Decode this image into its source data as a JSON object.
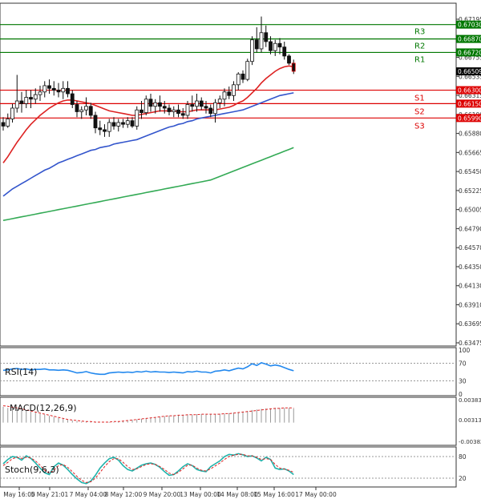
{
  "chart_data": {
    "type": "candlestick",
    "title": "",
    "main": {
      "ylim": [
        0.6347,
        0.6725
      ],
      "y_ticks": [
        "0.67195",
        "0.66975",
        "0.66755",
        "0.66535",
        "0.66315",
        "0.66100",
        "0.65880",
        "0.65665",
        "0.65450",
        "0.65225",
        "0.65005",
        "0.64790",
        "0.64570",
        "0.64350",
        "0.64130",
        "0.63910",
        "0.63695",
        "0.63475"
      ],
      "last_price": "0.66509",
      "levels": [
        {
          "name": "R3",
          "value": 0.6703,
          "label": "0.67030",
          "color": "#007700"
        },
        {
          "name": "R2",
          "value": 0.6687,
          "label": "0.66870",
          "color": "#007700"
        },
        {
          "name": "R1",
          "value": 0.6672,
          "label": "0.66720",
          "color": "#007700"
        },
        {
          "name": "S1",
          "value": 0.663,
          "label": "0.66300",
          "color": "#dd0000"
        },
        {
          "name": "S2",
          "value": 0.6615,
          "label": "0.66150",
          "color": "#dd0000"
        },
        {
          "name": "S3",
          "value": 0.6599,
          "label": "0.65990",
          "color": "#dd0000"
        }
      ],
      "ohlc": [
        [
          0.6594,
          0.66,
          0.6585,
          0.659
        ],
        [
          0.659,
          0.6604,
          0.6588,
          0.6598
        ],
        [
          0.6598,
          0.6615,
          0.6594,
          0.661
        ],
        [
          0.661,
          0.6647,
          0.6605,
          0.6618
        ],
        [
          0.6618,
          0.6628,
          0.6605,
          0.6615
        ],
        [
          0.6615,
          0.663,
          0.661,
          0.6622
        ],
        [
          0.6622,
          0.663,
          0.661,
          0.662
        ],
        [
          0.662,
          0.6632,
          0.6615,
          0.6625
        ],
        [
          0.6625,
          0.6635,
          0.6618,
          0.6628
        ],
        [
          0.6628,
          0.664,
          0.6622,
          0.6635
        ],
        [
          0.6635,
          0.6642,
          0.6626,
          0.6632
        ],
        [
          0.6632,
          0.664,
          0.6624,
          0.663
        ],
        [
          0.663,
          0.6638,
          0.6622,
          0.6628
        ],
        [
          0.6628,
          0.664,
          0.662,
          0.6632
        ],
        [
          0.6632,
          0.664,
          0.6622,
          0.6626
        ],
        [
          0.6626,
          0.663,
          0.661,
          0.6614
        ],
        [
          0.6614,
          0.6618,
          0.66,
          0.6606
        ],
        [
          0.6606,
          0.6612,
          0.6598,
          0.6608
        ],
        [
          0.6608,
          0.6622,
          0.6602,
          0.6612
        ],
        [
          0.6612,
          0.6616,
          0.6598,
          0.6602
        ],
        [
          0.6602,
          0.6606,
          0.6582,
          0.6588
        ],
        [
          0.6588,
          0.6596,
          0.658,
          0.6586
        ],
        [
          0.6586,
          0.6592,
          0.6578,
          0.6584
        ],
        [
          0.6584,
          0.6598,
          0.6578,
          0.6594
        ],
        [
          0.6594,
          0.66,
          0.6586,
          0.659
        ],
        [
          0.659,
          0.6598,
          0.6584,
          0.6594
        ],
        [
          0.6594,
          0.6598,
          0.6588,
          0.6592
        ],
        [
          0.6592,
          0.66,
          0.6588,
          0.6596
        ],
        [
          0.6596,
          0.66,
          0.6588,
          0.659
        ],
        [
          0.659,
          0.6612,
          0.6586,
          0.6608
        ],
        [
          0.6608,
          0.6618,
          0.6598,
          0.6605
        ],
        [
          0.6605,
          0.6624,
          0.6602,
          0.662
        ],
        [
          0.662,
          0.6626,
          0.6606,
          0.6612
        ],
        [
          0.6612,
          0.662,
          0.6604,
          0.6616
        ],
        [
          0.6616,
          0.6624,
          0.6606,
          0.6612
        ],
        [
          0.6612,
          0.6618,
          0.6604,
          0.661
        ],
        [
          0.661,
          0.6614,
          0.6602,
          0.6606
        ],
        [
          0.6606,
          0.6612,
          0.66,
          0.6608
        ],
        [
          0.6608,
          0.6614,
          0.66,
          0.6604
        ],
        [
          0.6604,
          0.661,
          0.6598,
          0.6602
        ],
        [
          0.6602,
          0.6618,
          0.6598,
          0.6614
        ],
        [
          0.6614,
          0.6624,
          0.6606,
          0.6612
        ],
        [
          0.6612,
          0.6626,
          0.6606,
          0.6618
        ],
        [
          0.6618,
          0.6622,
          0.6608,
          0.6612
        ],
        [
          0.6612,
          0.6618,
          0.6604,
          0.661
        ],
        [
          0.661,
          0.6614,
          0.66,
          0.6604
        ],
        [
          0.6604,
          0.662,
          0.6594,
          0.6616
        ],
        [
          0.6616,
          0.6624,
          0.661,
          0.662
        ],
        [
          0.662,
          0.6632,
          0.6612,
          0.6628
        ],
        [
          0.6628,
          0.6634,
          0.662,
          0.6624
        ],
        [
          0.6624,
          0.664,
          0.6618,
          0.6636
        ],
        [
          0.6636,
          0.665,
          0.663,
          0.6648
        ],
        [
          0.6648,
          0.6652,
          0.6638,
          0.6642
        ],
        [
          0.6642,
          0.6665,
          0.664,
          0.6662
        ],
        [
          0.6662,
          0.669,
          0.6658,
          0.6686
        ],
        [
          0.6686,
          0.67,
          0.6672,
          0.6676
        ],
        [
          0.6676,
          0.6712,
          0.6672,
          0.6694
        ],
        [
          0.6694,
          0.6702,
          0.6678,
          0.6684
        ],
        [
          0.6684,
          0.669,
          0.667,
          0.6674
        ],
        [
          0.6674,
          0.6686,
          0.6668,
          0.6682
        ],
        [
          0.6682,
          0.6688,
          0.667,
          0.6678
        ],
        [
          0.6678,
          0.6684,
          0.6664,
          0.6668
        ],
        [
          0.6668,
          0.667,
          0.6658,
          0.666
        ],
        [
          0.666,
          0.6664,
          0.6648,
          0.6651
        ]
      ],
      "ma_short": [
        0.6549,
        0.6556,
        0.6564,
        0.6572,
        0.6579,
        0.6586,
        0.6592,
        0.6597,
        0.6602,
        0.6606,
        0.661,
        0.6613,
        0.6616,
        0.6618,
        0.6619,
        0.6619,
        0.6618,
        0.6617,
        0.6616,
        0.6615,
        0.6613,
        0.6611,
        0.6609,
        0.6607,
        0.6606,
        0.6605,
        0.6604,
        0.6603,
        0.6602,
        0.6602,
        0.6603,
        0.6604,
        0.6605,
        0.6606,
        0.6607,
        0.6607,
        0.6607,
        0.6607,
        0.6606,
        0.6606,
        0.6606,
        0.6607,
        0.6608,
        0.6608,
        0.6608,
        0.6608,
        0.6608,
        0.6609,
        0.661,
        0.6611,
        0.6613,
        0.6616,
        0.6618,
        0.6622,
        0.6627,
        0.6632,
        0.6638,
        0.6643,
        0.6647,
        0.6651,
        0.6654,
        0.6656,
        0.6657,
        0.6656
      ],
      "ma_medium": [
        0.6512,
        0.6516,
        0.652,
        0.6523,
        0.6526,
        0.6529,
        0.6532,
        0.6535,
        0.6538,
        0.6541,
        0.6543,
        0.6546,
        0.6549,
        0.6551,
        0.6553,
        0.6555,
        0.6557,
        0.6559,
        0.6561,
        0.6563,
        0.6564,
        0.6566,
        0.6567,
        0.6568,
        0.657,
        0.6571,
        0.6572,
        0.6573,
        0.6574,
        0.6575,
        0.6577,
        0.6579,
        0.6581,
        0.6583,
        0.6585,
        0.6587,
        0.6589,
        0.659,
        0.6592,
        0.6593,
        0.6595,
        0.6596,
        0.6598,
        0.6599,
        0.66,
        0.6601,
        0.6602,
        0.6603,
        0.6604,
        0.6605,
        0.6606,
        0.6607,
        0.6608,
        0.661,
        0.6612,
        0.6614,
        0.6616,
        0.6618,
        0.662,
        0.6622,
        0.6624,
        0.6625,
        0.6626,
        0.6627
      ],
      "ma_long": [
        0.6485,
        0.6486,
        0.6487,
        0.6488,
        0.6489,
        0.649,
        0.6491,
        0.6492,
        0.6493,
        0.6494,
        0.6495,
        0.6496,
        0.6497,
        0.6498,
        0.6499,
        0.65,
        0.6501,
        0.6502,
        0.6503,
        0.6504,
        0.6505,
        0.6506,
        0.6507,
        0.6508,
        0.6509,
        0.651,
        0.6511,
        0.6512,
        0.6513,
        0.6514,
        0.6515,
        0.6516,
        0.6517,
        0.6518,
        0.6519,
        0.652,
        0.6521,
        0.6522,
        0.6523,
        0.6524,
        0.6525,
        0.6526,
        0.6527,
        0.6528,
        0.6529,
        0.653,
        0.6532,
        0.6534,
        0.6536,
        0.6538,
        0.654,
        0.6542,
        0.6544,
        0.6546,
        0.6548,
        0.655,
        0.6552,
        0.6554,
        0.6556,
        0.6558,
        0.656,
        0.6562,
        0.6564,
        0.6566
      ]
    },
    "rsi": {
      "label": "RSI(14)",
      "ylim": [
        0,
        100
      ],
      "y_ticks": [
        "100",
        "70",
        "30",
        "0"
      ],
      "values": [
        54,
        55,
        57,
        58,
        56,
        57,
        55,
        56,
        56,
        57,
        55,
        55,
        54,
        55,
        54,
        51,
        48,
        49,
        51,
        48,
        46,
        45,
        45,
        48,
        49,
        50,
        49,
        50,
        49,
        51,
        50,
        52,
        50,
        51,
        50,
        50,
        49,
        50,
        49,
        48,
        51,
        50,
        52,
        50,
        50,
        48,
        52,
        53,
        55,
        53,
        56,
        59,
        57,
        62,
        69,
        65,
        71,
        68,
        64,
        66,
        64,
        60,
        56,
        53
      ]
    },
    "macd": {
      "label": "MACD(12,26,9)",
      "ylim": [
        -0.004,
        0.0045
      ],
      "y_ticks": [
        "0.003837",
        "0.00313",
        "-0.003827"
      ],
      "histogram": [
        0.003,
        0.0028,
        0.0027,
        0.0026,
        0.0024,
        0.0023,
        0.0021,
        0.0019,
        0.0017,
        0.0015,
        0.0013,
        0.0011,
        0.0009,
        0.0007,
        0.0005,
        0.0004,
        0.0003,
        0.0002,
        0.0002,
        0.0001,
        0.0001,
        0.0,
        0.0,
        0.0001,
        0.0001,
        0.0002,
        0.0003,
        0.0004,
        0.0005,
        0.0006,
        0.0007,
        0.0008,
        0.0009,
        0.001,
        0.0011,
        0.0012,
        0.0013,
        0.0014,
        0.0014,
        0.0015,
        0.0015,
        0.0015,
        0.0016,
        0.0016,
        0.0016,
        0.0016,
        0.0016,
        0.0017,
        0.0017,
        0.0018,
        0.0019,
        0.002,
        0.0021,
        0.0022,
        0.0024,
        0.0025,
        0.0026,
        0.0027,
        0.0027,
        0.0028,
        0.0028,
        0.0028,
        0.0028,
        0.0027
      ],
      "signal": [
        0.0032,
        0.0031,
        0.0029,
        0.0028,
        0.0026,
        0.0024,
        0.0022,
        0.002,
        0.0018,
        0.0016,
        0.0014,
        0.0012,
        0.001,
        0.0008,
        0.0006,
        0.0005,
        0.0004,
        0.0003,
        0.0002,
        0.0002,
        0.0001,
        0.0001,
        0.0001,
        0.0001,
        0.0002,
        0.0002,
        0.0003,
        0.0004,
        0.0005,
        0.0006,
        0.0007,
        0.0008,
        0.0009,
        0.001,
        0.0011,
        0.0012,
        0.0013,
        0.0013,
        0.0014,
        0.0014,
        0.0015,
        0.0015,
        0.0015,
        0.0016,
        0.0016,
        0.0016,
        0.0016,
        0.0016,
        0.0017,
        0.0017,
        0.0018,
        0.0019,
        0.002,
        0.0021,
        0.0022,
        0.0023,
        0.0024,
        0.0025,
        0.0026,
        0.0027,
        0.0027,
        0.0028,
        0.0028,
        0.0028
      ]
    },
    "stoch": {
      "label": "Stoch(9,6,3)",
      "ylim": [
        0,
        100
      ],
      "y_ticks": [
        "80",
        "20"
      ],
      "main": [
        60,
        72,
        80,
        78,
        70,
        82,
        75,
        62,
        48,
        35,
        30,
        52,
        62,
        56,
        44,
        30,
        18,
        8,
        5,
        12,
        28,
        48,
        62,
        74,
        78,
        70,
        55,
        44,
        40,
        48,
        56,
        60,
        62,
        58,
        50,
        38,
        28,
        30,
        40,
        52,
        60,
        55,
        44,
        40,
        38,
        52,
        60,
        68,
        80,
        86,
        84,
        88,
        85,
        80,
        82,
        76,
        68,
        78,
        72,
        48,
        44,
        46,
        40,
        30
      ],
      "signal": [
        55,
        64,
        74,
        78,
        75,
        78,
        76,
        68,
        56,
        42,
        34,
        42,
        55,
        58,
        50,
        38,
        25,
        14,
        8,
        10,
        20,
        36,
        52,
        66,
        74,
        74,
        64,
        52,
        44,
        46,
        52,
        58,
        60,
        58,
        52,
        44,
        34,
        30,
        36,
        46,
        56,
        56,
        48,
        42,
        40,
        46,
        54,
        62,
        72,
        80,
        84,
        86,
        86,
        82,
        82,
        78,
        72,
        74,
        72,
        58,
        48,
        45,
        42,
        36
      ]
    },
    "x_ticks": [
      "May 16:00",
      "5 May 21:01",
      "7 May 04:00",
      "8 May 12:00",
      "9 May 20:00",
      "13 May 00:00",
      "14 May 08:00",
      "15 May 16:00",
      "17 May 00:00"
    ]
  }
}
